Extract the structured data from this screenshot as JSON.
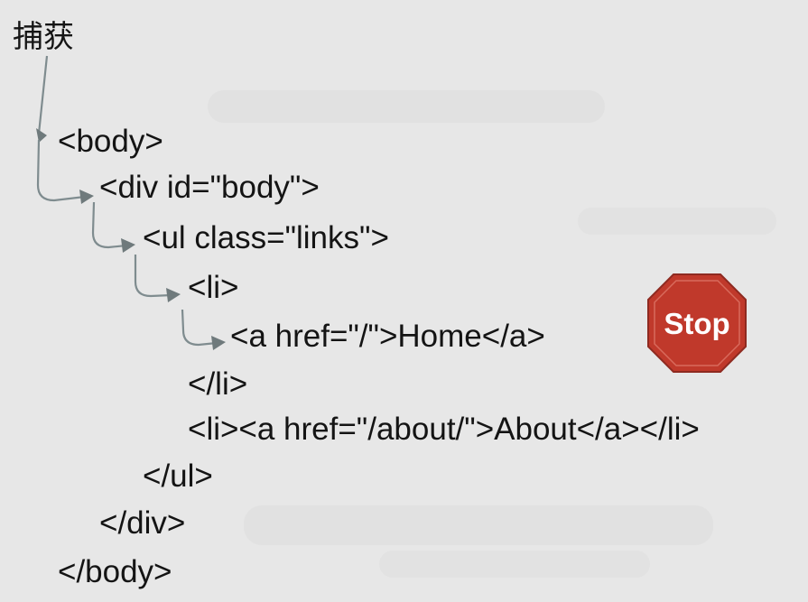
{
  "title": "捕获",
  "code_lines": [
    "<body>",
    "<div id=\"body\">",
    "<ul class=\"links\">",
    "<li>",
    "<a href=\"/\">Home</a>",
    "</li>",
    "<li><a href=\"/about/\">About</a></li>",
    "</ul>",
    "</div>",
    "</body>"
  ],
  "stop_sign": {
    "label": "Stop",
    "color": "#c0392b"
  },
  "arrow_color": "#7f8c8f"
}
